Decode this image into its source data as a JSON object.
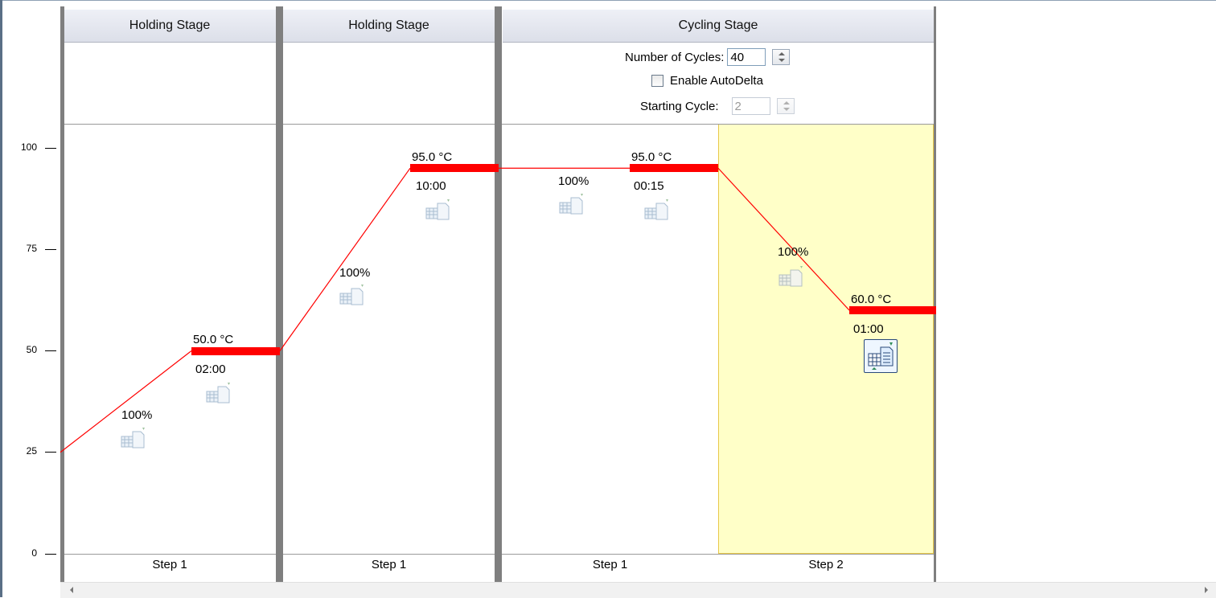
{
  "y_axis": {
    "ticks": [
      "100",
      "75",
      "50",
      "25",
      "0"
    ]
  },
  "stages": [
    {
      "title": "Holding Stage"
    },
    {
      "title": "Holding Stage"
    },
    {
      "title": "Cycling Stage",
      "cycles_label": "Number of Cycles:",
      "cycles_value": "40",
      "autodelta_label": "Enable AutoDelta",
      "autodelta_checked": false,
      "starting_cycle_label": "Starting Cycle:",
      "starting_cycle_value": "2"
    }
  ],
  "steps": [
    {
      "label": "Step 1",
      "temperature": "50.0 °C",
      "time": "02:00",
      "ramp": "100%"
    },
    {
      "label": "Step 1",
      "temperature": "95.0 °C",
      "time": "10:00",
      "ramp": "100%"
    },
    {
      "label": "Step 1",
      "temperature": "95.0 °C",
      "time": "00:15",
      "ramp": "100%"
    },
    {
      "label": "Step 2",
      "temperature": "60.0 °C",
      "time": "01:00",
      "ramp": "100%",
      "selected": true
    }
  ],
  "chart_data": {
    "type": "line",
    "y_ticks": [
      100,
      75,
      50,
      25,
      0
    ],
    "ylim": [
      0,
      100
    ],
    "start_temperature": 25,
    "setpoints": [
      50.0,
      95.0,
      95.0,
      60.0
    ],
    "colors": {
      "line": "#ff0000",
      "selected_step_bg": "#ffffc8"
    }
  }
}
